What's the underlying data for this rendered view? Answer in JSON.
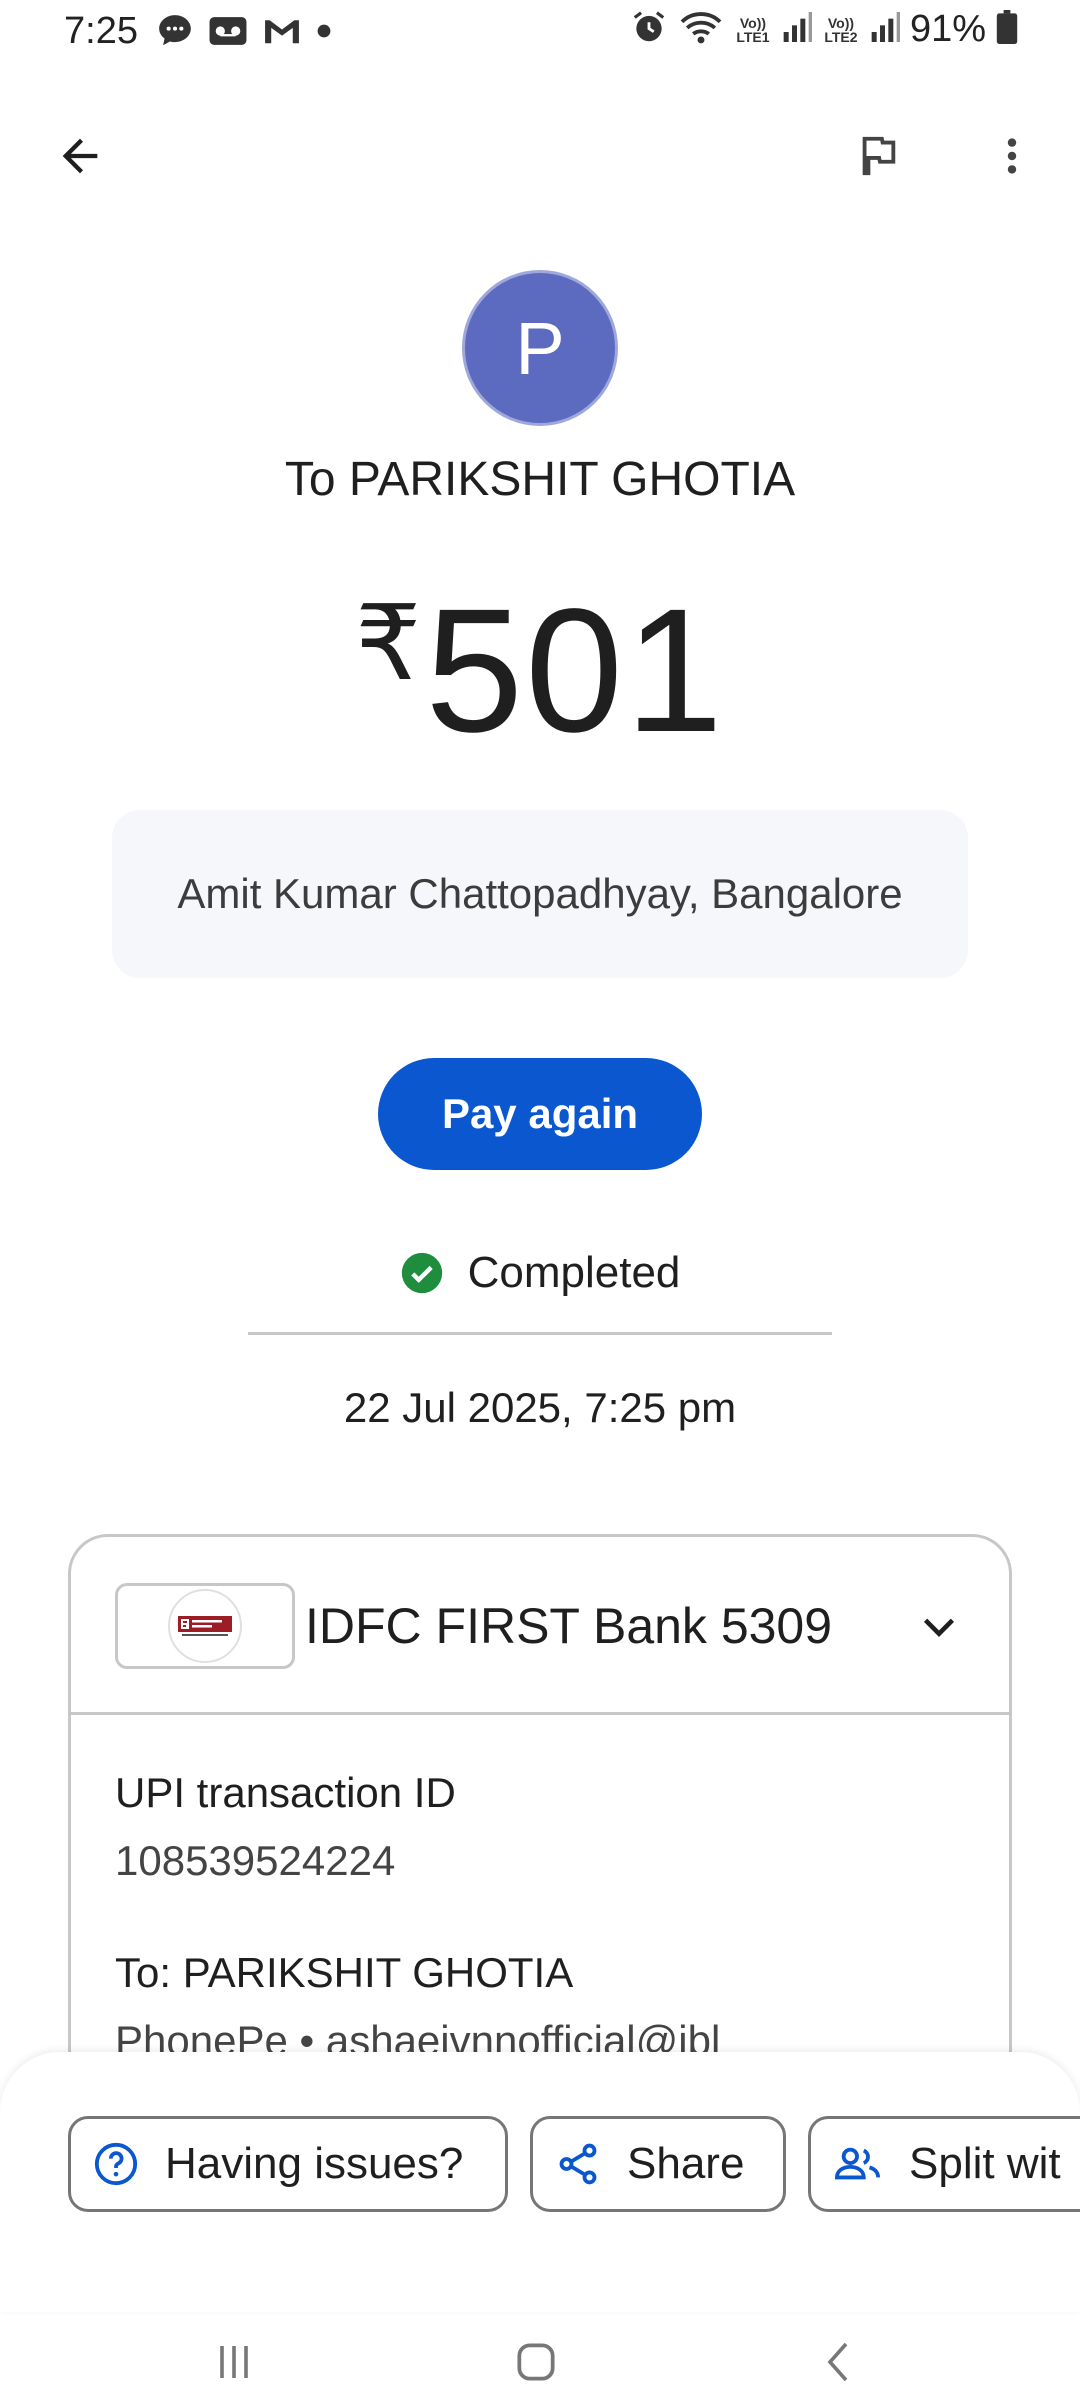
{
  "status_bar": {
    "time": "7:25",
    "battery": "91%",
    "net1": "Vo)) LTE1",
    "net2": "Vo)) LTE2",
    "left_icons": [
      "chat-icon",
      "voicemail-icon",
      "gmail-icon",
      "dot-icon"
    ],
    "right_icons": [
      "alarm-icon",
      "wifi-icon",
      "signal-icon",
      "battery-icon"
    ]
  },
  "app_bar": {
    "back_icon": "arrow-back-icon",
    "flag_icon": "flag-icon",
    "more_icon": "more-vert-icon"
  },
  "payment": {
    "avatar_letter": "P",
    "title": "To PARIKSHIT GHOTIA",
    "currency": "₹",
    "amount": "501",
    "note": "Amit Kumar Chattopadhyay, Bangalore",
    "pay_again_label": "Pay again",
    "status": "Completed",
    "datetime": "22 Jul 2025, 7:25 pm"
  },
  "details": {
    "bank_name": "IDFC FIRST Bank 5309",
    "bank_logo_text": "IDFC FIRST Bank",
    "bank_logo_tagline": "ALWAYS YOU FIRST",
    "upi_label": "UPI transaction ID",
    "upi_value": "108539524224",
    "to_label": "To: PARIKSHIT GHOTIA",
    "to_value": "PhonePe • ashaeivnnofficial@ibl"
  },
  "actions": {
    "issues_label": "Having issues?",
    "share_label": "Share",
    "split_label": "Split wit"
  },
  "colors": {
    "primary": "#0b57d0",
    "avatar": "#5c6bc0",
    "success": "#1e8e3e",
    "note_bg": "#f5f7fb"
  }
}
